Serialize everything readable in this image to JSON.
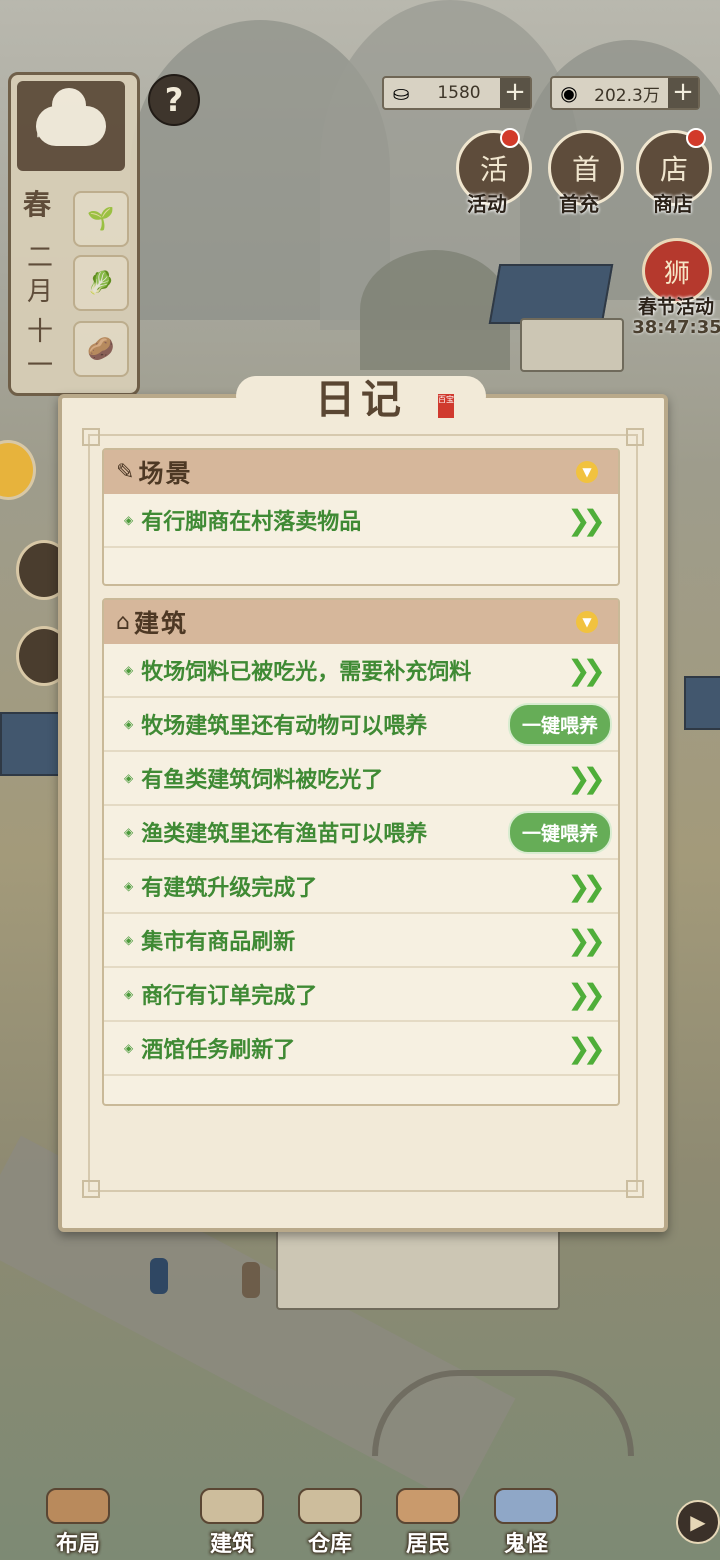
{
  "resources": {
    "silver_value": "1580",
    "coins_value": "202.3万"
  },
  "top_menu": [
    {
      "label": "活动",
      "icon_char": "活"
    },
    {
      "label": "首充",
      "icon_char": "首"
    },
    {
      "label": "商店",
      "icon_char": "店"
    }
  ],
  "event": {
    "label": "春节活动",
    "timer": "38:47:35",
    "icon_char": "狮"
  },
  "calendar": {
    "season": "春",
    "month_line1": "二",
    "month_line2": "月",
    "day_line1": "十",
    "day_line2": "一"
  },
  "help_icon": "?",
  "diary": {
    "title": "日记",
    "seal": "百宝",
    "sections": [
      {
        "title": "场景",
        "rows": [
          {
            "text": "有行脚商在村落卖物品",
            "action": "arrow"
          }
        ]
      },
      {
        "title": "建筑",
        "rows": [
          {
            "text": "牧场饲料已被吃光，需要补充饲料",
            "action": "arrow"
          },
          {
            "text": "牧场建筑里还有动物可以喂养",
            "action": "button",
            "button_label": "一键喂养"
          },
          {
            "text": "有鱼类建筑饲料被吃光了",
            "action": "arrow"
          },
          {
            "text": "渔类建筑里还有渔苗可以喂养",
            "action": "button",
            "button_label": "一键喂养"
          },
          {
            "text": "有建筑升级完成了",
            "action": "arrow"
          },
          {
            "text": "集市有商品刷新",
            "action": "arrow"
          },
          {
            "text": "商行有订单完成了",
            "action": "arrow"
          },
          {
            "text": "酒馆任务刷新了",
            "action": "arrow"
          }
        ]
      }
    ],
    "arrow_glyph": "❯❯"
  },
  "bottom_nav": [
    {
      "label": "布局"
    },
    {
      "label": "建筑"
    },
    {
      "label": "仓库"
    },
    {
      "label": "居民"
    },
    {
      "label": "鬼怪"
    }
  ],
  "colors": {
    "green_text": "#3f8a34",
    "header_tan": "#d6b79b",
    "button_green": "#66ad57"
  }
}
